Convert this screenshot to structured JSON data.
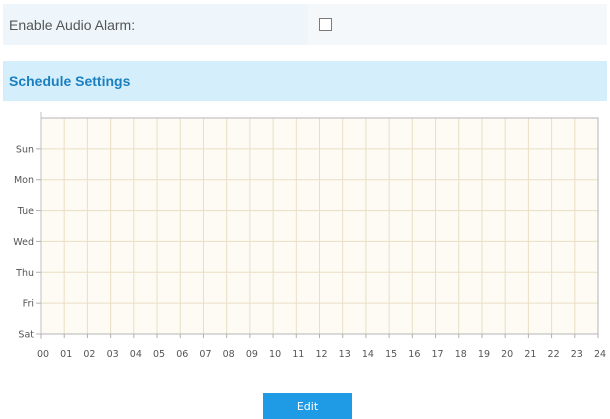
{
  "audio_alarm": {
    "label": "Enable Audio Alarm:",
    "checked": false
  },
  "schedule": {
    "title": "Schedule Settings",
    "days": [
      "Sun",
      "Mon",
      "Tue",
      "Wed",
      "Thu",
      "Fri",
      "Sat"
    ],
    "hours": [
      "00",
      "01",
      "02",
      "03",
      "04",
      "05",
      "06",
      "07",
      "08",
      "09",
      "10",
      "11",
      "12",
      "13",
      "14",
      "15",
      "16",
      "17",
      "18",
      "19",
      "20",
      "21",
      "22",
      "23",
      "24"
    ],
    "scheduled_blocks": []
  },
  "actions": {
    "edit_label": "Edit"
  },
  "colors": {
    "grid_bg": "#fdfbf3",
    "grid_line": "#eadfc6",
    "accent": "#1f9be6",
    "section_bg": "#d4effb",
    "section_text": "#1a7fc1"
  }
}
